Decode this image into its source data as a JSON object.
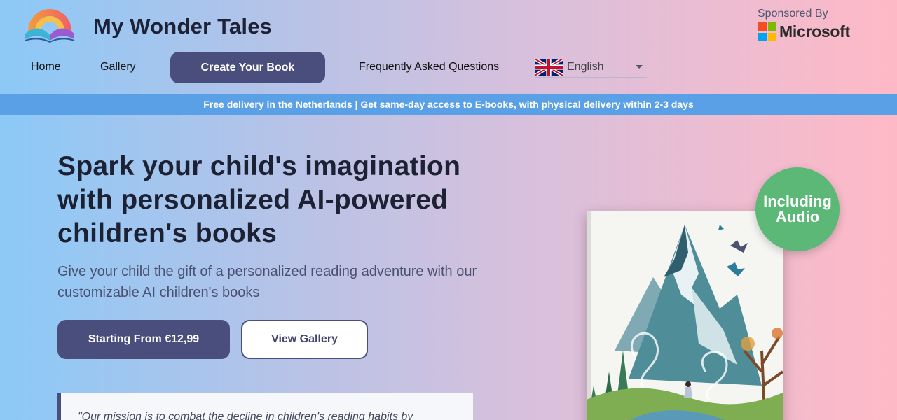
{
  "header": {
    "brand": "My Wonder Tales",
    "sponsor_label": "Sponsored By",
    "sponsor_name": "Microsoft",
    "sponsor_colors": [
      "#f25022",
      "#7fba00",
      "#00a4ef",
      "#ffb900"
    ]
  },
  "nav": {
    "home": "Home",
    "gallery": "Gallery",
    "create": "Create Your Book",
    "faq": "Frequently Asked Questions",
    "language": "English"
  },
  "banner": {
    "text": "Free delivery in the Netherlands | Get same-day access to E-books, with physical delivery within 2-3 days"
  },
  "hero": {
    "title": "Spark your child's imagination with personalized AI-powered children's books",
    "subtitle": "Give your child the gift of a personalized reading adventure with our customizable AI children's books",
    "primary_cta": "Starting From €12,99",
    "secondary_cta": "View Gallery",
    "quote": "\"Our mission is to combat the decline in children's reading habits by"
  },
  "book": {
    "badge_line1": "Including",
    "badge_line2": "Audio"
  },
  "colors": {
    "primary": "#4a4e7c",
    "banner": "#5aa0e6",
    "badge": "#5cb877"
  }
}
